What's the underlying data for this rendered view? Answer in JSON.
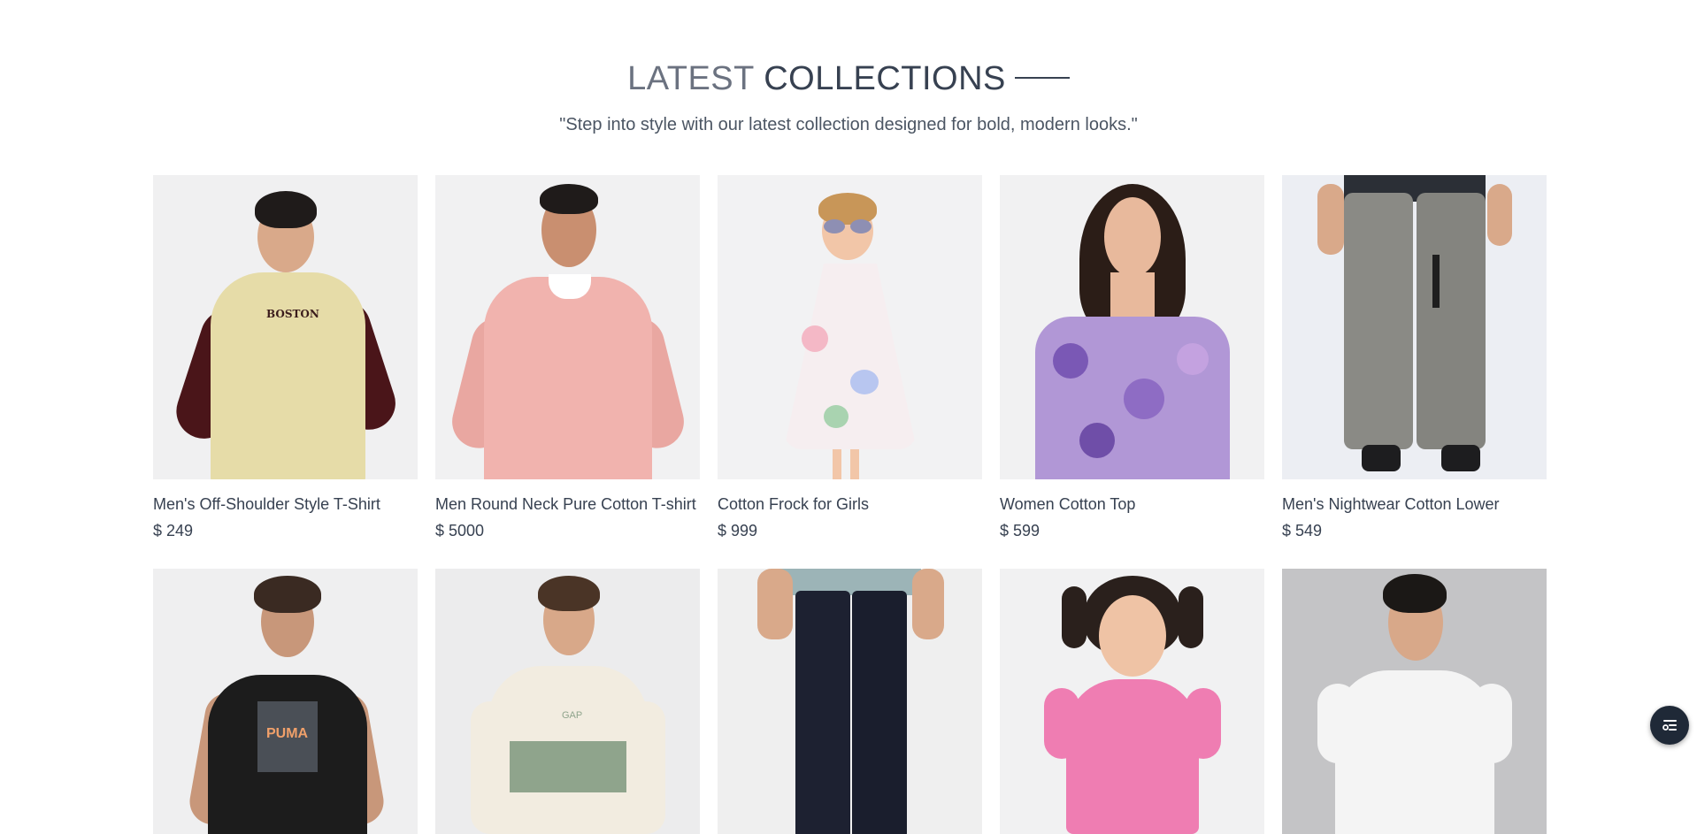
{
  "section": {
    "title_light": "LATEST",
    "title_dark": "COLLECTIONS",
    "subtitle": "\"Step into style with our latest collection designed for bold, modern looks.\""
  },
  "products": [
    {
      "name": "Men's Off-Shoulder Style T-Shirt",
      "price": "$ 249",
      "print_text": "BOSTON"
    },
    {
      "name": "Men Round Neck Pure Cotton T-shirt",
      "price": "$ 5000"
    },
    {
      "name": "Cotton Frock for Girls",
      "price": "$ 999"
    },
    {
      "name": "Women Cotton Top",
      "price": "$ 599"
    },
    {
      "name": "Men's Nightwear Cotton Lower",
      "price": "$ 549"
    }
  ],
  "products_row2": [
    {
      "image": "black-puma-tshirt",
      "print_text": "PUMA"
    },
    {
      "image": "striped-rugby-polo",
      "print_text": "GAP"
    },
    {
      "image": "navy-jeans"
    },
    {
      "image": "girl-pink-top"
    },
    {
      "image": "white-tshirt"
    }
  ],
  "floating_action": {
    "icon": "list-settings-icon"
  }
}
